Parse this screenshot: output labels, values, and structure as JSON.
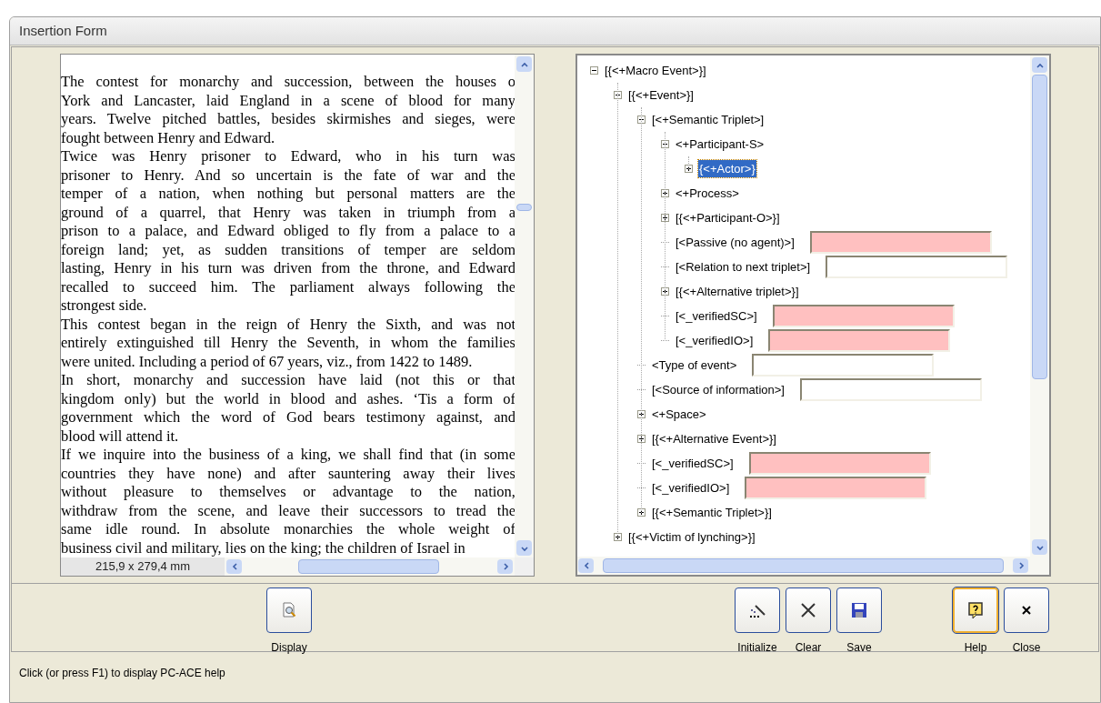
{
  "window": {
    "title": "Insertion Form"
  },
  "document": {
    "paragraphs": [
      [
        "The contest for monarchy and succession, between the houses o",
        "York and Lancaster, laid England in a scene of blood for many",
        "years. Twelve pitched battles, besides skirmishes and sieges, were",
        "fought between Henry and Edward."
      ],
      [
        "Twice was Henry prisoner to Edward, who in his turn was",
        "prisoner to Henry. And so uncertain is the fate of war and the",
        "temper of a nation, when nothing but personal matters are the",
        "ground of a quarrel, that Henry was taken in triumph from a",
        "prison to a palace, and Edward obliged to fly from a palace to a",
        "foreign land; yet, as sudden transitions of temper are seldom",
        "lasting, Henry in his turn was driven from the throne, and Edward",
        "recalled to succeed him. The parliament always following the",
        "strongest side."
      ],
      [
        "This contest began in the reign of Henry the Sixth, and was not",
        "entirely extinguished till Henry the Seventh, in whom the families",
        "were united. Including a period of 67 years, viz., from 1422 to 1489."
      ],
      [
        "In short, monarchy and succession have laid (not this or that",
        "kingdom only) but the world in blood and ashes. ‘Tis a form of",
        "government which the word of God bears testimony against, and",
        "blood will attend it."
      ],
      [
        "If we inquire into the business of a king, we shall find that (in some",
        "countries they have none) and after sauntering away their lives",
        "without pleasure to themselves or advantage to the nation,",
        "withdraw from the scene, and leave their successors to tread the",
        "same idle round. In absolute monarchies the whole weight of",
        "business civil and military, lies on the king; the children of Israel in"
      ]
    ],
    "page_size": "215,9 x 279,4 mm"
  },
  "tree": [
    {
      "label": "[{<+Macro Event>}]",
      "expanded": true,
      "selected": false,
      "children": [
        {
          "label": "[{<+Event>}]",
          "expanded": true,
          "selected": false,
          "children": [
            {
              "label": "[<+Semantic Triplet>]",
              "expanded": true,
              "selected": false,
              "children": [
                {
                  "label": "<+Participant-S>",
                  "expanded": true,
                  "selected": false,
                  "children": [
                    {
                      "label": "{<+Actor>}",
                      "expanded": false,
                      "selected": true
                    }
                  ]
                },
                {
                  "label": "<+Process>",
                  "expanded": false,
                  "selected": false
                },
                {
                  "label": "[{<+Participant-O>}]",
                  "expanded": false,
                  "selected": false
                },
                {
                  "label": "[<Passive (no agent)>]",
                  "selected": false,
                  "field": {
                    "required": true
                  }
                },
                {
                  "label": "[<Relation to next triplet>]",
                  "selected": false,
                  "field": {
                    "required": false
                  }
                },
                {
                  "label": "[{<+Alternative triplet>}]",
                  "expanded": false,
                  "selected": false
                },
                {
                  "label": "[<_verifiedSC>]",
                  "selected": false,
                  "field": {
                    "required": true
                  }
                },
                {
                  "label": "[<_verifiedIO>]",
                  "selected": false,
                  "field": {
                    "required": true
                  }
                }
              ]
            },
            {
              "label": "<Type of event>",
              "selected": false,
              "field": {
                "required": false
              }
            },
            {
              "label": "[<Source of information>]",
              "selected": false,
              "field": {
                "required": false
              }
            },
            {
              "label": "<+Space>",
              "expanded": false,
              "selected": false
            },
            {
              "label": "[{<+Alternative Event>}]",
              "expanded": false,
              "selected": false
            },
            {
              "label": "[<_verifiedSC>]",
              "selected": false,
              "field": {
                "required": true
              }
            },
            {
              "label": "[<_verifiedIO>]",
              "selected": false,
              "field": {
                "required": true
              }
            },
            {
              "label": "[{<+Semantic Triplet>}]",
              "expanded": false,
              "selected": false
            }
          ]
        },
        {
          "label": "[{<+Victim of lynching>}]",
          "expanded": false,
          "selected": false
        }
      ]
    }
  ],
  "toolbar": [
    {
      "label": "Display",
      "kind": "display",
      "focused": false
    },
    {
      "label": "Initialize",
      "kind": "initialize",
      "focused": false
    },
    {
      "label": "Clear",
      "kind": "clear",
      "focused": false
    },
    {
      "label": "Save",
      "kind": "save",
      "focused": false
    },
    {
      "label": "Help",
      "kind": "help",
      "focused": true
    },
    {
      "label": "Close",
      "kind": "close",
      "focused": false
    }
  ],
  "status_bar": "Click (or press F1) to display PC-ACE help"
}
